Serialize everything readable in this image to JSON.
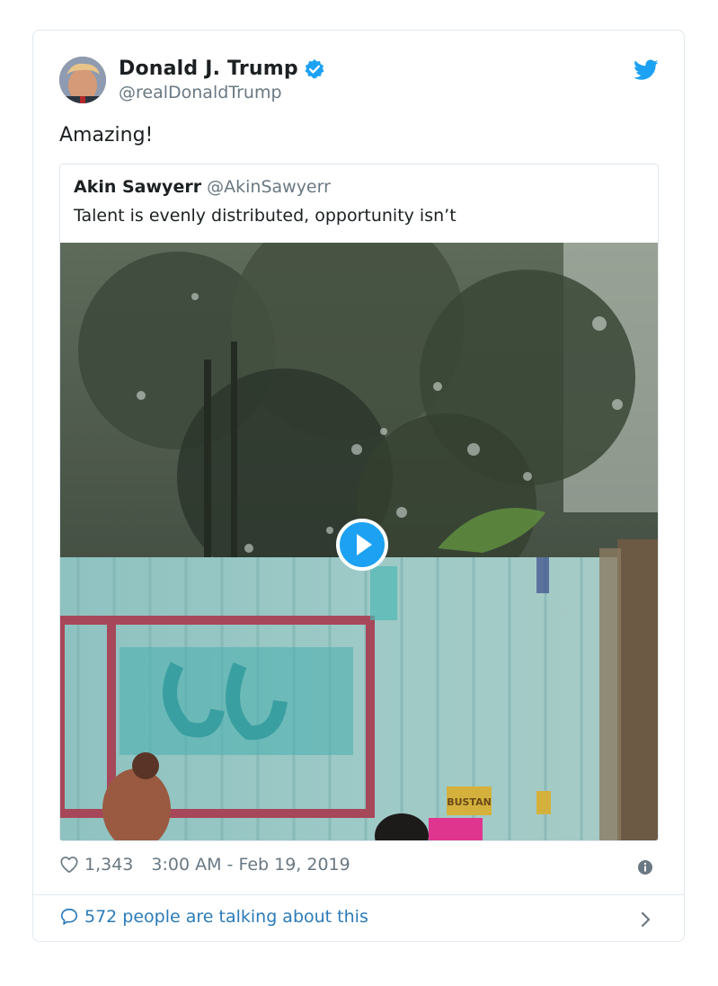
{
  "tweet": {
    "author_name": "Donald J. Trump",
    "author_handle": "@realDonaldTrump",
    "text": "Amazing!",
    "likes": "1,343",
    "timestamp": "3:00 AM - Feb 19, 2019",
    "talking": "572 people are talking about this"
  },
  "quoted": {
    "author_name": "Akin Sawyerr",
    "author_handle": "@AkinSawyerr",
    "text": "Talent is evenly distributed, opportunity isn’t",
    "media_sign": "BUSTAN"
  },
  "icons": {
    "verified": "verified-badge-icon",
    "brand": "twitter-bird-icon",
    "like": "heart-icon",
    "info": "info-icon",
    "reply": "speech-bubble-icon",
    "more": "chevron-right-icon",
    "play": "play-icon"
  },
  "colors": {
    "brand": "#1da1f2",
    "link": "#2b7bb9",
    "muted": "#697882",
    "text": "#1c2022",
    "border": "#e1e8ed"
  }
}
